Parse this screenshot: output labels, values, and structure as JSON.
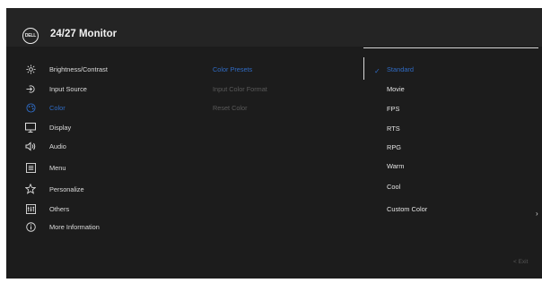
{
  "header": {
    "logo_text": "DELL",
    "title": "24/27 Monitor"
  },
  "menu": [
    {
      "label": "Brightness/Contrast",
      "icon": "brightness-icon"
    },
    {
      "label": "Input Source",
      "icon": "input-source-icon"
    },
    {
      "label": "Color",
      "icon": "color-icon",
      "active": true
    },
    {
      "label": "Display",
      "icon": "display-icon"
    },
    {
      "label": "Audio",
      "icon": "audio-icon"
    },
    {
      "label": "Menu",
      "icon": "menu-icon"
    },
    {
      "label": "Personalize",
      "icon": "star-icon"
    },
    {
      "label": "Others",
      "icon": "others-icon"
    },
    {
      "label": "More Information",
      "icon": "info-icon"
    }
  ],
  "submenu": [
    {
      "label": "Color Presets",
      "active": true
    },
    {
      "label": "Input Color Format"
    },
    {
      "label": "Reset Color"
    }
  ],
  "options": [
    {
      "label": "Standard",
      "selected": true
    },
    {
      "label": "Movie"
    },
    {
      "label": "FPS"
    },
    {
      "label": "RTS"
    },
    {
      "label": "RPG"
    },
    {
      "label": "Warm"
    },
    {
      "label": "Cool"
    },
    {
      "label": "Custom Color",
      "has_submenu": true
    }
  ],
  "footer": {
    "exit_label": "< Exit"
  },
  "colors": {
    "accent": "#2f6bc4",
    "panel": "#1c1c1c",
    "header": "#242424",
    "text": "#dcdcdc",
    "disabled": "#5a5a5a"
  }
}
